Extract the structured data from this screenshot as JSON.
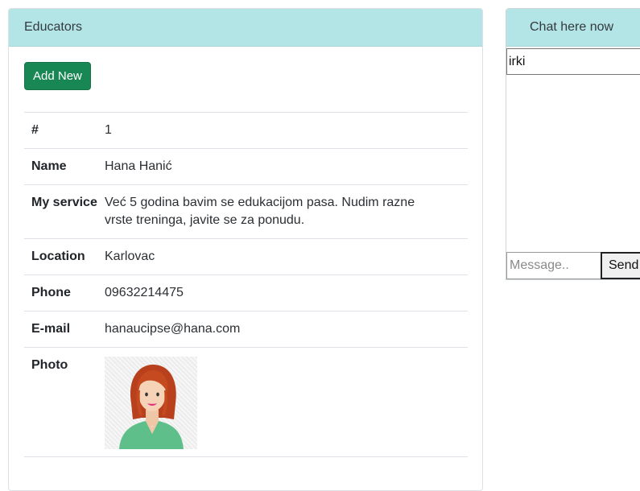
{
  "educators": {
    "header": "Educators",
    "add_button": "Add New",
    "rows": {
      "id": {
        "label": "#",
        "value": "1"
      },
      "name": {
        "label": "Name",
        "value": "Hana Hanić"
      },
      "service": {
        "label": "My service",
        "value": "Već 5 godina bavim se edukacijom pasa. Nudim razne vrste treninga, javite se za ponudu."
      },
      "location": {
        "label": "Location",
        "value": "Karlovac"
      },
      "phone": {
        "label": "Phone",
        "value": "09632214475"
      },
      "email": {
        "label": "E-mail",
        "value": "hanaucipse@hana.com"
      },
      "photo": {
        "label": "Photo",
        "icon": "female-avatar-icon"
      }
    }
  },
  "chat": {
    "header": "Chat here now",
    "user_value": "irki",
    "message_placeholder": "Message..",
    "send_label": "Send"
  },
  "colors": {
    "header_bg": "#b3e5e6",
    "button_green": "#198754"
  }
}
